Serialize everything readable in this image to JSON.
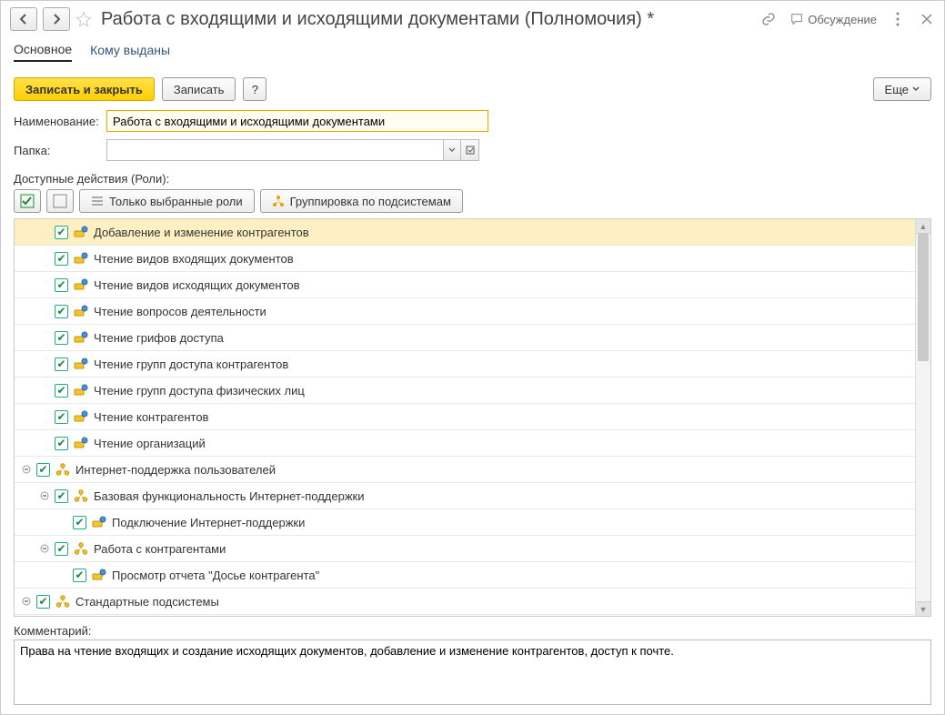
{
  "header": {
    "title": "Работа с входящими и исходящими документами (Полномочия) *",
    "discuss": "Обсуждение"
  },
  "tabs": {
    "main": "Основное",
    "issued": "Кому выданы"
  },
  "toolbar": {
    "save_close": "Записать и закрыть",
    "save": "Записать",
    "help": "?",
    "more": "Еще"
  },
  "form": {
    "name_label": "Наименование:",
    "name_value": "Работа с входящими и исходящими документами",
    "folder_label": "Папка:",
    "folder_value": ""
  },
  "roles": {
    "section_label": "Доступные действия (Роли):",
    "only_selected": "Только выбранные роли",
    "group_subsys": "Группировка по подсистемам"
  },
  "tree": [
    {
      "indent": 1,
      "expander": "",
      "checked": true,
      "icon": "role",
      "label": "Добавление и изменение контрагентов",
      "selected": true
    },
    {
      "indent": 1,
      "expander": "",
      "checked": true,
      "icon": "role",
      "label": "Чтение видов входящих документов"
    },
    {
      "indent": 1,
      "expander": "",
      "checked": true,
      "icon": "role",
      "label": "Чтение видов исходящих документов"
    },
    {
      "indent": 1,
      "expander": "",
      "checked": true,
      "icon": "role",
      "label": "Чтение вопросов деятельности"
    },
    {
      "indent": 1,
      "expander": "",
      "checked": true,
      "icon": "role",
      "label": "Чтение грифов доступа"
    },
    {
      "indent": 1,
      "expander": "",
      "checked": true,
      "icon": "role",
      "label": "Чтение групп доступа контрагентов"
    },
    {
      "indent": 1,
      "expander": "",
      "checked": true,
      "icon": "role",
      "label": "Чтение групп доступа физических лиц"
    },
    {
      "indent": 1,
      "expander": "",
      "checked": true,
      "icon": "role",
      "label": "Чтение контрагентов"
    },
    {
      "indent": 1,
      "expander": "",
      "checked": true,
      "icon": "role",
      "label": "Чтение организаций"
    },
    {
      "indent": 0,
      "expander": "minus",
      "checked": true,
      "icon": "subsys",
      "label": "Интернет-поддержка пользователей"
    },
    {
      "indent": 1,
      "expander": "minus",
      "checked": true,
      "icon": "subsys",
      "label": "Базовая функциональность Интернет-поддержки"
    },
    {
      "indent": 2,
      "expander": "",
      "checked": true,
      "icon": "role",
      "label": "Подключение Интернет-поддержки"
    },
    {
      "indent": 1,
      "expander": "minus",
      "checked": true,
      "icon": "subsys",
      "label": "Работа с контрагентами"
    },
    {
      "indent": 2,
      "expander": "",
      "checked": true,
      "icon": "role",
      "label": "Просмотр отчета \"Досье контрагента\""
    },
    {
      "indent": 0,
      "expander": "minus",
      "checked": true,
      "icon": "subsys",
      "label": "Стандартные подсистемы"
    }
  ],
  "comment": {
    "label": "Комментарий:",
    "value": "Права на чтение входящих и создание исходящих документов, добавление и изменение контрагентов, доступ к почте."
  }
}
